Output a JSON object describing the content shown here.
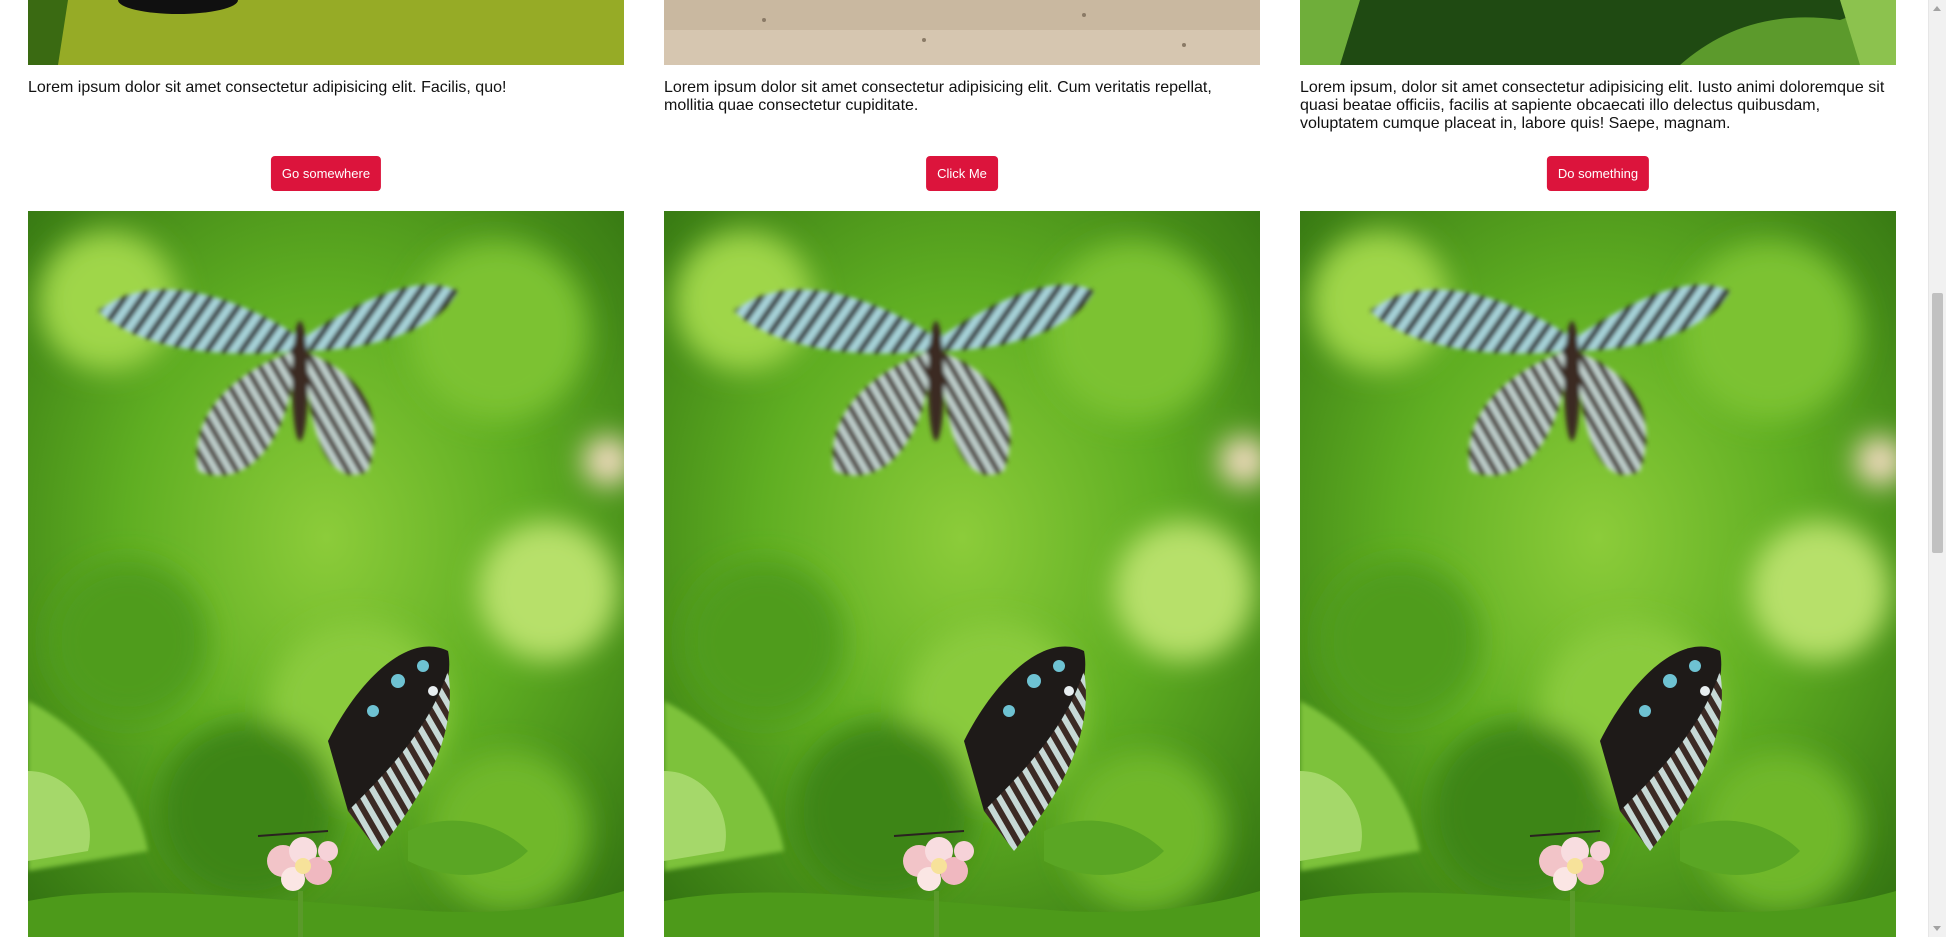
{
  "cards": [
    {
      "text": "Lorem ipsum dolor sit amet consectetur adipisicing elit. Facilis, quo!",
      "button_label": "Go somewhere",
      "top_image": "yellow-green-leaf-photo-cropped",
      "bottom_image": "butterflies-on-green-foliage-photo"
    },
    {
      "text": "Lorem ipsum dolor sit amet consectetur adipisicing elit. Cum veritatis repellat, mollitia quae consectetur cupiditate.",
      "button_label": "Click Me",
      "top_image": "sandy-ground-photo-cropped",
      "bottom_image": "butterflies-on-green-foliage-photo"
    },
    {
      "text": "Lorem ipsum, dolor sit amet consectetur adipisicing elit. Iusto animi doloremque sit quasi beatae officiis, facilis at sapiente obcaecati illo delectus quibusdam, voluptatem cumque placeat in, labore quis! Saepe, magnam.",
      "button_label": "Do something",
      "top_image": "green-foliage-photo-cropped",
      "bottom_image": "butterflies-on-green-foliage-photo"
    }
  ],
  "colors": {
    "button_bg": "#dc143c",
    "button_text": "#ffffff",
    "body_text": "#111111",
    "foliage_green": "#6ab523"
  }
}
